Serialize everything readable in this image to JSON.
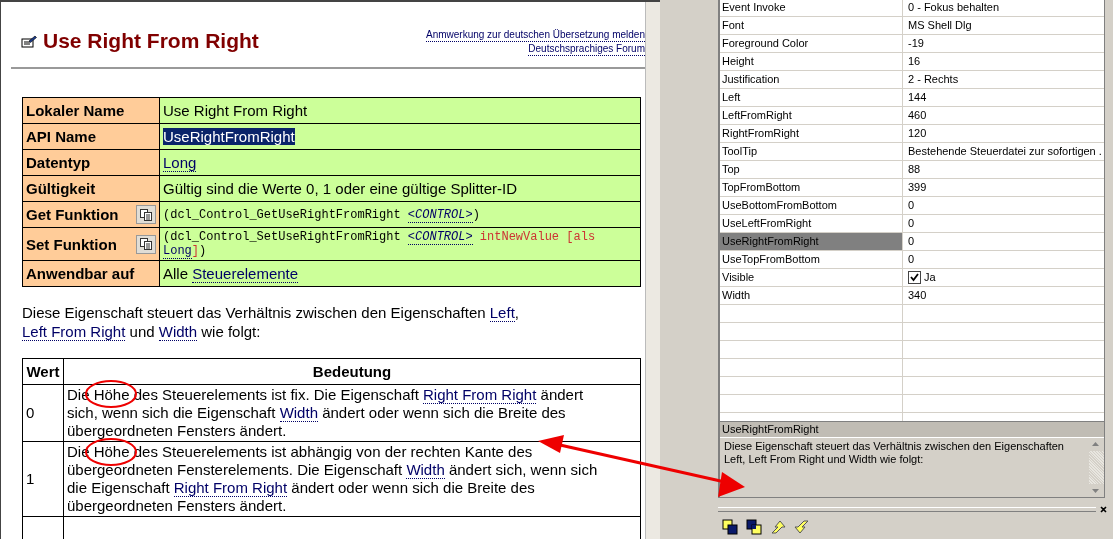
{
  "help_page": {
    "title": "Use Right From Right",
    "header_links": [
      "Anmwerkung zur deutschen Übersetzung melden",
      "Deutschsprachiges Forum"
    ],
    "info_rows": [
      {
        "label": "Lokaler Name",
        "copy_button": false,
        "code": false,
        "value": [
          {
            "kind": "plain",
            "text": "Use Right From Right"
          }
        ]
      },
      {
        "label": "API Name",
        "copy_button": false,
        "code": false,
        "value": [
          {
            "kind": "highlighted",
            "text": "UseRightFromRight"
          }
        ]
      },
      {
        "label": "Datentyp",
        "copy_button": false,
        "code": false,
        "value": [
          {
            "kind": "link",
            "text": "Long"
          }
        ]
      },
      {
        "label": "Gültigkeit",
        "copy_button": false,
        "code": false,
        "value": [
          {
            "kind": "plain",
            "text": "Gültig sind die Werte 0, 1 oder eine gültige Splitter-ID"
          }
        ]
      },
      {
        "label": "Get Funktion",
        "copy_button": true,
        "code": true,
        "value": [
          {
            "kind": "plain",
            "text": "(dcl_Control_GetUseRightFromRight "
          },
          {
            "kind": "italic-link",
            "text": "<CONTROL>"
          },
          {
            "kind": "plain",
            "text": ")"
          }
        ]
      },
      {
        "label": "Set Funktion",
        "copy_button": true,
        "code": true,
        "value": [
          {
            "kind": "plain",
            "text": "(dcl_Control_SetUseRightFromRight "
          },
          {
            "kind": "italic-link",
            "text": "<CONTROL>"
          },
          {
            "kind": "parameter",
            "text": " intNewValue [als "
          },
          {
            "kind": "link",
            "text": "Long"
          },
          {
            "kind": "parameter",
            "text": "]"
          },
          {
            "kind": "plain",
            "text": ")"
          }
        ]
      },
      {
        "label": "Anwendbar auf",
        "copy_button": false,
        "code": false,
        "value": [
          {
            "kind": "plain",
            "text": "Alle "
          },
          {
            "kind": "link",
            "text": "Steuerelemente"
          }
        ]
      }
    ],
    "intro": [
      {
        "kind": "plain",
        "text": "Diese Eigenschaft steuert das Verhältnis zwischen den Eigenschaften "
      },
      {
        "kind": "link",
        "text": "Left"
      },
      {
        "kind": "plain",
        "text": ", "
      },
      {
        "kind": "link",
        "text": "Left From Right"
      },
      {
        "kind": "plain",
        "text": " und "
      },
      {
        "kind": "link",
        "text": "Width"
      },
      {
        "kind": "plain",
        "text": " wie folgt:"
      }
    ],
    "values_table": {
      "columns": [
        "Wert",
        "Bedeutung"
      ],
      "rows": [
        {
          "value": "0",
          "meaning": [
            {
              "kind": "plain",
              "text": "Die Höhe des Steuerelements ist fix. Die Eigenschaft "
            },
            {
              "kind": "link",
              "text": "Right From Right"
            },
            {
              "kind": "plain",
              "text": " ändert sich, wenn sich die Eigenschaft "
            },
            {
              "kind": "link",
              "text": "Width"
            },
            {
              "kind": "plain",
              "text": " ändert oder wenn sich die Breite des übergeordneten Fensters ändert."
            }
          ]
        },
        {
          "value": "1",
          "meaning": [
            {
              "kind": "plain",
              "text": "Die Höhe des Steuerelements ist abhängig von der rechten Kante des übergeordneten Fensterelements. Die Eigenschaft "
            },
            {
              "kind": "link",
              "text": "Width"
            },
            {
              "kind": "plain",
              "text": " ändert sich, wenn sich die Eigenschaft "
            },
            {
              "kind": "link",
              "text": "Right From Right"
            },
            {
              "kind": "plain",
              "text": " ändert oder wenn sich die Breite des übergeordneten Fensters ändert."
            }
          ]
        }
      ]
    }
  },
  "property_grid": {
    "rows": [
      {
        "name": "Event Invoke",
        "value": "0 - Fokus behalten",
        "kind": "text",
        "selected": false
      },
      {
        "name": "Font",
        "value": "MS Shell Dlg",
        "kind": "text",
        "selected": false
      },
      {
        "name": "Foreground Color",
        "value": "-19",
        "kind": "text",
        "selected": false
      },
      {
        "name": "Height",
        "value": "16",
        "kind": "text",
        "selected": false
      },
      {
        "name": "Justification",
        "value": "2 - Rechts",
        "kind": "text",
        "selected": false
      },
      {
        "name": "Left",
        "value": "144",
        "kind": "text",
        "selected": false
      },
      {
        "name": "LeftFromRight",
        "value": "460",
        "kind": "text",
        "selected": false
      },
      {
        "name": "RightFromRight",
        "value": "120",
        "kind": "text",
        "selected": false
      },
      {
        "name": "ToolTip",
        "value": "Bestehende Steuerdatei zur sofortigen .",
        "kind": "text",
        "selected": false
      },
      {
        "name": "Top",
        "value": "88",
        "kind": "text",
        "selected": false
      },
      {
        "name": "TopFromBottom",
        "value": "399",
        "kind": "text",
        "selected": false
      },
      {
        "name": "UseBottomFromBottom",
        "value": "0",
        "kind": "text",
        "selected": false
      },
      {
        "name": "UseLeftFromRight",
        "value": "0",
        "kind": "text",
        "selected": false
      },
      {
        "name": "UseRightFromRight",
        "value": "0",
        "kind": "text",
        "selected": true
      },
      {
        "name": "UseTopFromBottom",
        "value": "0",
        "kind": "text",
        "selected": false
      },
      {
        "name": "Visible",
        "value": "Ja",
        "kind": "checkbox",
        "checked": true,
        "selected": false
      },
      {
        "name": "Width",
        "value": "340",
        "kind": "text",
        "selected": false
      }
    ],
    "description": {
      "title": "UseRightFromRight",
      "text": "Diese Eigenschaft steuert das Verhältnis zwischen den Eigenschaften Left, Left From Right und Width wie folgt:"
    }
  }
}
